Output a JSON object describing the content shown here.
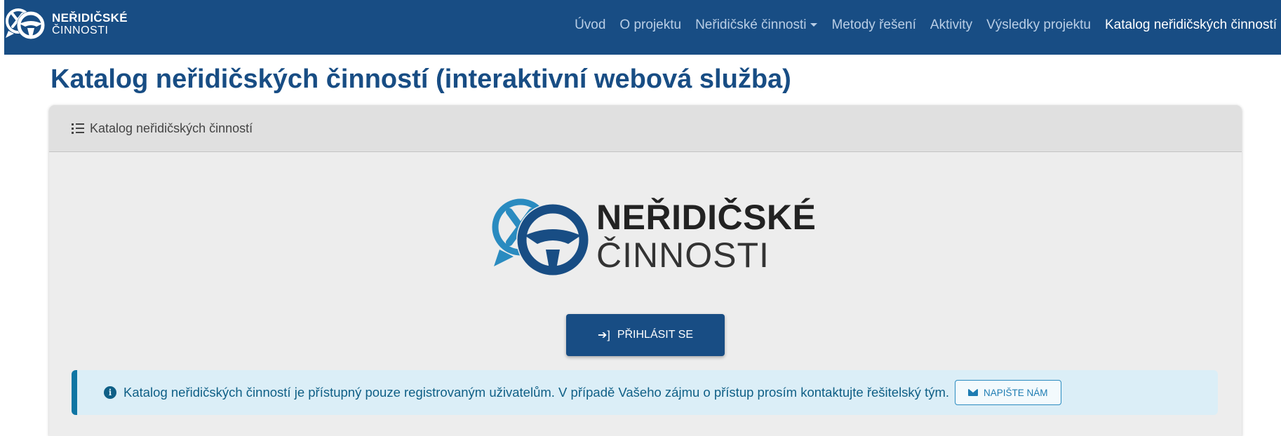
{
  "colors": {
    "primary": "#184d84",
    "accent": "#2a8bc0",
    "info_bg": "#dbeef7",
    "info_text": "#0f5f86"
  },
  "navbar": {
    "brand": {
      "line1": "NEŘIDIČSKÉ",
      "line2": "ČINNOSTI",
      "icon": "steering-wheel-logo-icon"
    },
    "items": [
      {
        "label": "Úvod"
      },
      {
        "label": "O projektu"
      },
      {
        "label": "Neřidičské činnosti",
        "dropdown": true
      },
      {
        "label": "Metody řešení"
      },
      {
        "label": "Aktivity"
      },
      {
        "label": "Výsledky projektu"
      },
      {
        "label": "Katalog neřidičských činností",
        "active": true
      }
    ]
  },
  "page": {
    "title": "Katalog neřidičských činností (interaktivní webová služba)"
  },
  "card": {
    "header": {
      "label": "Katalog neřidičských činností",
      "icon": "list-icon"
    },
    "logo": {
      "line1": "NEŘIDIČSKÉ",
      "line2": "ČINNOSTI"
    },
    "login_button": {
      "label": "PŘIHLÁSIT SE",
      "icon": "sign-in-icon"
    },
    "alert": {
      "icon": "info-icon",
      "text": "Katalog neřidičských činností je přístupný pouze registrovaným uživatelům. V případě Vašeho zájmu o přístup prosím kontaktujte řešitelský tým.",
      "button_label": "NAPIŠTE NÁM",
      "button_icon": "envelope-icon"
    }
  }
}
